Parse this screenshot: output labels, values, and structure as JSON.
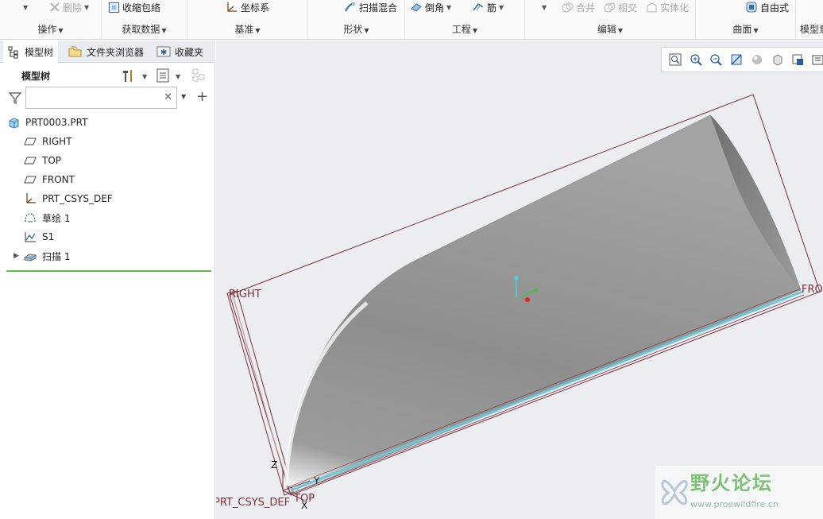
{
  "ribbon": {
    "groups": [
      {
        "label": "操作"
      },
      {
        "label": "获取数据"
      },
      {
        "label": "基准"
      },
      {
        "label": "形状"
      },
      {
        "label": "工程"
      },
      {
        "label": "编辑"
      },
      {
        "label": "曲面"
      },
      {
        "label": "模型意"
      }
    ],
    "commands": {
      "delete": "删除",
      "shrinkwrap": "收缩包络",
      "csys": "坐标系",
      "swept_blend": "扫描混合",
      "round": "倒角",
      "rib": "筋",
      "merge": "合并",
      "intersect": "相交",
      "solidify": "实体化",
      "freestyle": "自由式"
    }
  },
  "left_pane": {
    "tabs": [
      {
        "label": "模型树",
        "active": true
      },
      {
        "label": "文件夹浏览器",
        "active": false
      },
      {
        "label": "收藏夹",
        "active": false
      }
    ],
    "tree_title": "模型树",
    "filter": {
      "value": "",
      "placeholder": ""
    },
    "tree": [
      {
        "label": "PRT0003.PRT",
        "icon": "part-icon"
      },
      {
        "label": "RIGHT",
        "icon": "datum-plane-icon"
      },
      {
        "label": "TOP",
        "icon": "datum-plane-icon"
      },
      {
        "label": "FRONT",
        "icon": "datum-plane-icon"
      },
      {
        "label": "PRT_CSYS_DEF",
        "icon": "csys-icon"
      },
      {
        "label": "草绘 1",
        "icon": "sketch-icon"
      },
      {
        "label": "S1",
        "icon": "datum-curve-icon"
      },
      {
        "label": "扫描 1",
        "icon": "sweep-icon"
      }
    ]
  },
  "viewport": {
    "datum_labels": {
      "right": "RIGHT",
      "front": "FRO",
      "top": "TOP",
      "csys": "PRT_CSYS_DEF"
    },
    "axis_labels": {
      "z": "Z",
      "y": "Y",
      "x": "X"
    },
    "colors": {
      "background": "#ebedf0",
      "datum": "#7a2f3b",
      "surface": "#9a9a9a",
      "edge_highlight": "#6cc6d9"
    }
  },
  "watermark": {
    "title": "野火论坛",
    "url": "www.proewildfire.cn"
  }
}
